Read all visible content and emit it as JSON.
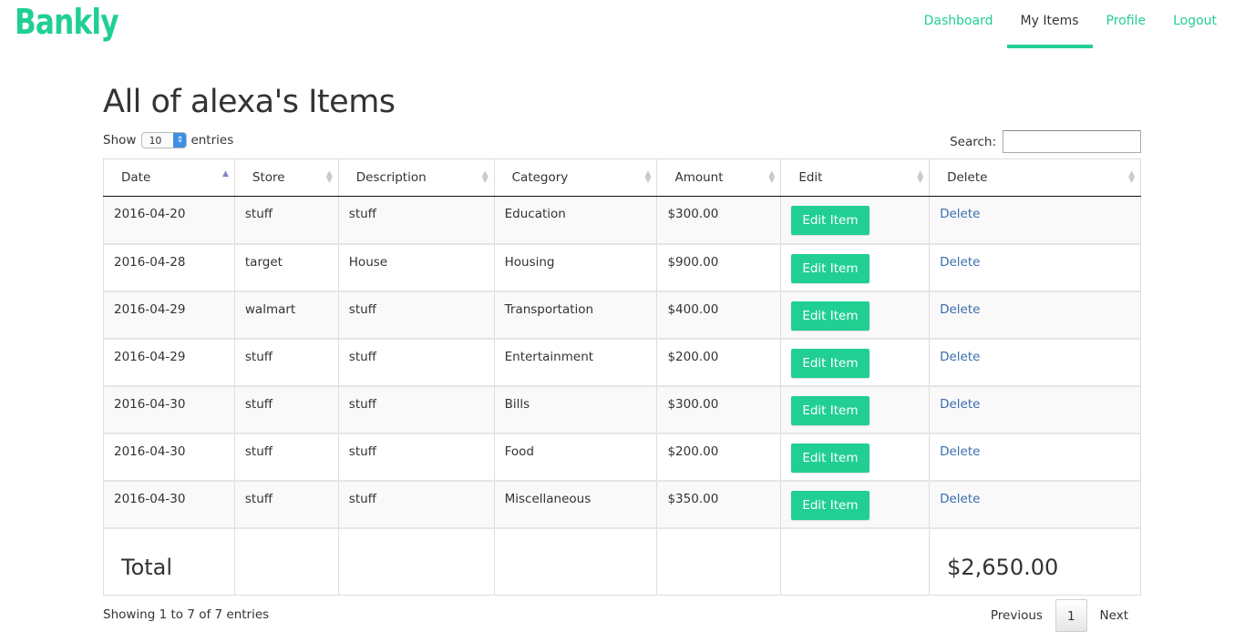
{
  "brand": "Bankly",
  "nav": {
    "dashboard": "Dashboard",
    "my_items": "My Items",
    "profile": "Profile",
    "logout": "Logout"
  },
  "page_title": "All of alexa's Items",
  "length": {
    "show": "Show",
    "value": "10",
    "entries": "entries"
  },
  "search": {
    "label": "Search:",
    "value": ""
  },
  "columns": [
    "Date",
    "Store",
    "Description",
    "Category",
    "Amount",
    "Edit",
    "Delete"
  ],
  "rows": [
    {
      "date": "2016-04-20",
      "store": "stuff",
      "description": "stuff",
      "category": "Education",
      "amount": "$300.00",
      "edit": "Edit Item",
      "delete": "Delete"
    },
    {
      "date": "2016-04-28",
      "store": "target",
      "description": "House",
      "category": "Housing",
      "amount": "$900.00",
      "edit": "Edit Item",
      "delete": "Delete"
    },
    {
      "date": "2016-04-29",
      "store": "walmart",
      "description": "stuff",
      "category": "Transportation",
      "amount": "$400.00",
      "edit": "Edit Item",
      "delete": "Delete"
    },
    {
      "date": "2016-04-29",
      "store": "stuff",
      "description": "stuff",
      "category": "Entertainment",
      "amount": "$200.00",
      "edit": "Edit Item",
      "delete": "Delete"
    },
    {
      "date": "2016-04-30",
      "store": "stuff",
      "description": "stuff",
      "category": "Bills",
      "amount": "$300.00",
      "edit": "Edit Item",
      "delete": "Delete"
    },
    {
      "date": "2016-04-30",
      "store": "stuff",
      "description": "stuff",
      "category": "Food",
      "amount": "$200.00",
      "edit": "Edit Item",
      "delete": "Delete"
    },
    {
      "date": "2016-04-30",
      "store": "stuff",
      "description": "stuff",
      "category": "Miscellaneous",
      "amount": "$350.00",
      "edit": "Edit Item",
      "delete": "Delete"
    }
  ],
  "footer": {
    "label": "Total",
    "total": "$2,650.00"
  },
  "info": "Showing 1 to 7 of 7 entries",
  "pagination": {
    "previous": "Previous",
    "current": "1",
    "next": "Next"
  },
  "colors": {
    "accent": "#21cf93",
    "link": "#3a6dae",
    "sort_active": "#7f86c8"
  },
  "sort": {
    "column": "Date",
    "direction": "ascending"
  }
}
